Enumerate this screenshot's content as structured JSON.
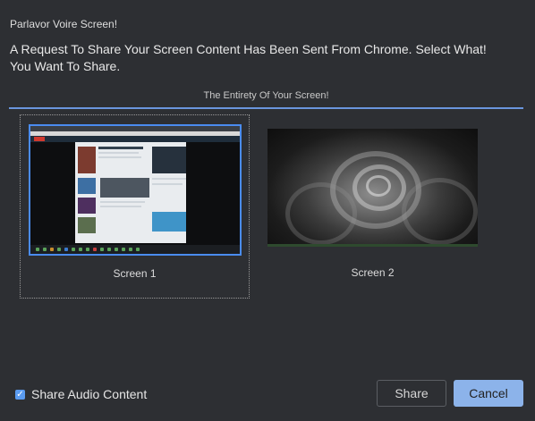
{
  "dialog": {
    "title": "Parlavor Voire Screen!",
    "prompt": "A Request To Share Your Screen Content Has Been Sent From Chrome. Select What! You Want To Share."
  },
  "tab": {
    "label": "The Entirety Of Your Screen!"
  },
  "screens": [
    {
      "label": "Screen 1",
      "selected": true,
      "thumbnail": "browser-window-screenshot"
    },
    {
      "label": "Screen 2",
      "selected": false,
      "thumbnail": "grayscale-rose-wallpaper"
    }
  ],
  "audio": {
    "label": "Share Audio Content",
    "checked": true
  },
  "buttons": {
    "share": "Share",
    "cancel": "Cancel"
  },
  "colors": {
    "background": "#2d2f33",
    "accent": "#4a8cf0",
    "cancel_button": "#8cb3ea"
  }
}
